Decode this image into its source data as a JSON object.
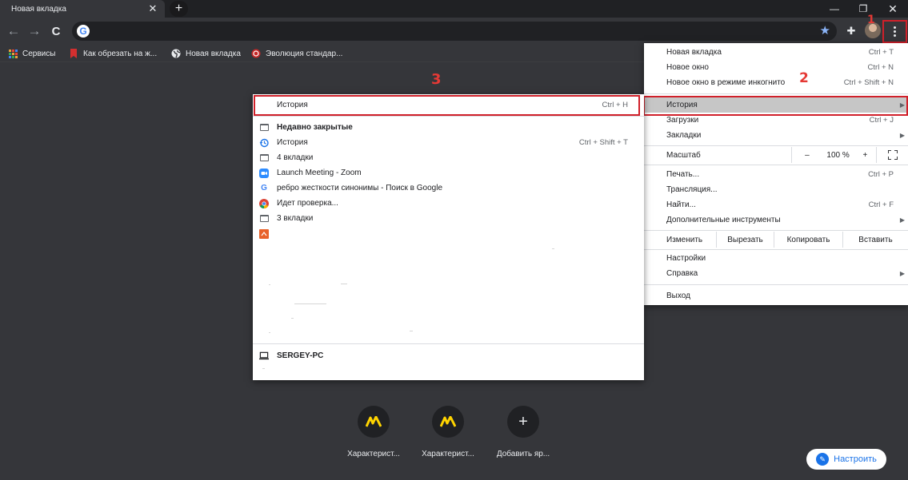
{
  "tab": {
    "title": "Новая вкладка",
    "close": "✕",
    "new_tab": "+"
  },
  "window_controls": {
    "minimize": "—",
    "restore": "❐",
    "close": "✕"
  },
  "toolbar": {
    "back": "←",
    "forward": "→",
    "reload": "C",
    "google_logo": "G",
    "bookmark_star": "★",
    "extensions": "✚"
  },
  "bookmarks": [
    {
      "label": "Сервисы",
      "icon": "apps-grid-icon"
    },
    {
      "label": "Как обрезать на ж...",
      "icon": "red-bookmark-icon"
    },
    {
      "label": "Новая вкладка",
      "icon": "globe-icon"
    },
    {
      "label": "Эволюция стандар...",
      "icon": "red-circle-icon"
    }
  ],
  "annotations": {
    "marker1": "1",
    "marker2": "2",
    "marker3": "3"
  },
  "main_menu": {
    "new_tab": {
      "label": "Новая вкладка",
      "shortcut": "Ctrl + T"
    },
    "new_window": {
      "label": "Новое окно",
      "shortcut": "Ctrl + N"
    },
    "incognito": {
      "label": "Новое окно в режиме инкогнито",
      "shortcut": "Ctrl + Shift + N"
    },
    "history": {
      "label": "История"
    },
    "downloads": {
      "label": "Загрузки",
      "shortcut": "Ctrl + J"
    },
    "bookmarks": {
      "label": "Закладки"
    },
    "zoom": {
      "label": "Масштаб",
      "minus": "–",
      "value": "100 %",
      "plus": "+"
    },
    "print": {
      "label": "Печать...",
      "shortcut": "Ctrl + P"
    },
    "cast": {
      "label": "Трансляция..."
    },
    "find": {
      "label": "Найти...",
      "shortcut": "Ctrl + F"
    },
    "more_tools": {
      "label": "Дополнительные инструменты"
    },
    "edit": {
      "label": "Изменить",
      "cut": "Вырезать",
      "copy": "Копировать",
      "paste": "Вставить"
    },
    "settings": {
      "label": "Настройки"
    },
    "help": {
      "label": "Справка"
    },
    "exit": {
      "label": "Выход"
    }
  },
  "history_menu": {
    "history": {
      "label": "История",
      "shortcut": "Ctrl + H"
    },
    "recently_closed": "Недавно закрытые",
    "items": [
      {
        "label": "История",
        "shortcut": "Ctrl + Shift + T",
        "icon": "history-icon"
      },
      {
        "label": "4 вкладки",
        "shortcut": "",
        "icon": "window-icon"
      },
      {
        "label": "Launch Meeting - Zoom",
        "shortcut": "",
        "icon": "zoom-icon"
      },
      {
        "label": "ребро жесткости синонимы - Поиск в Google",
        "shortcut": "",
        "icon": "google-icon"
      },
      {
        "label": "Идет проверка...",
        "shortcut": "",
        "icon": "chrome-icon"
      },
      {
        "label": "3 вкладки",
        "shortcut": "",
        "icon": "window-icon"
      },
      {
        "label": "",
        "shortcut": "",
        "icon": "orange-site-icon"
      }
    ],
    "device": "SERGEY-PC"
  },
  "shortcuts": [
    {
      "label": "Характерист...",
      "icon": "yandex-market-icon"
    },
    {
      "label": "Характерист...",
      "icon": "yandex-market-icon"
    },
    {
      "label": "Добавить яр...",
      "icon": "plus-icon"
    }
  ],
  "customize": {
    "label": "Настроить"
  },
  "colors": {
    "accent": "#1a73e8",
    "annotation_red": "#d0202a",
    "background": "#35363a"
  }
}
